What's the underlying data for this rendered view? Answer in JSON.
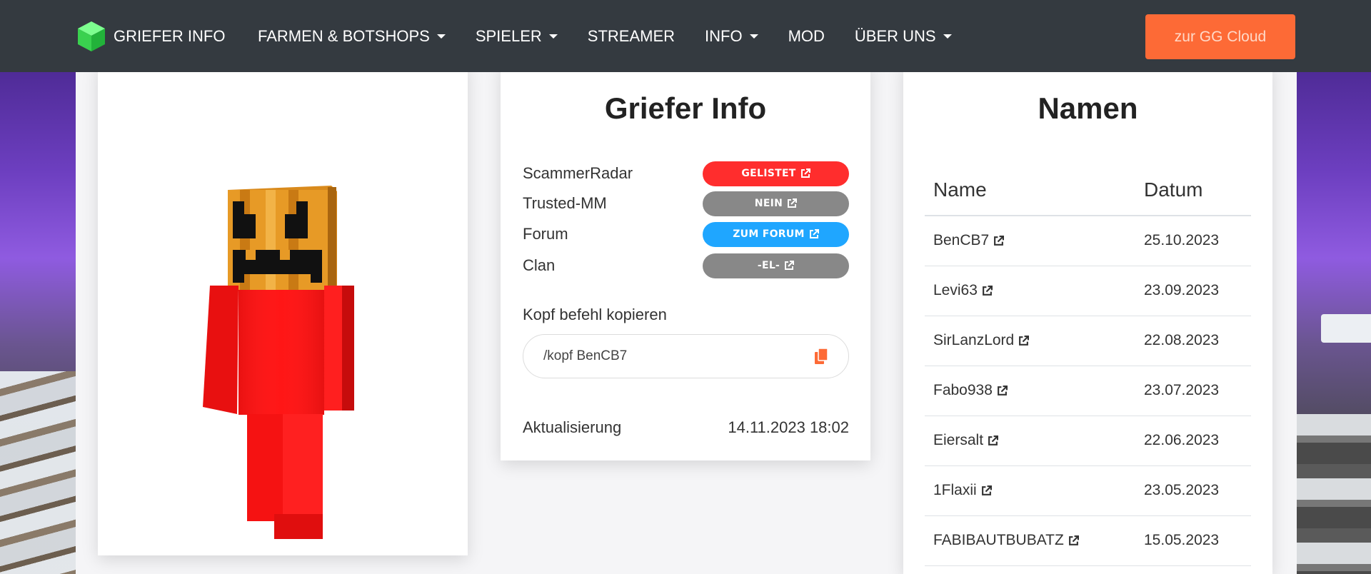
{
  "navbar": {
    "brand": "GRIEFER INFO",
    "items": [
      {
        "label": "FARMEN & BOTSHOPS",
        "dropdown": true
      },
      {
        "label": "SPIELER",
        "dropdown": true
      },
      {
        "label": "STREAMER",
        "dropdown": false
      },
      {
        "label": "INFO",
        "dropdown": true
      },
      {
        "label": "MOD",
        "dropdown": false
      },
      {
        "label": "ÜBER UNS",
        "dropdown": true
      }
    ],
    "cta": "zur GG Cloud"
  },
  "info_card": {
    "title": "Griefer Info",
    "rows": [
      {
        "label": "ScammerRadar",
        "badge": "GELISTET",
        "color": "#ff2d2d"
      },
      {
        "label": "Trusted-MM",
        "badge": "NEIN",
        "color": "#888888"
      },
      {
        "label": "Forum",
        "badge": "ZUM FORUM",
        "color": "#1fa6ff"
      },
      {
        "label": "Clan",
        "badge": "-EL-",
        "color": "#888888"
      }
    ],
    "copy_label": "Kopf befehl kopieren",
    "copy_value": "/kopf BenCB7",
    "update_label": "Aktualisierung",
    "update_value": "14.11.2023 18:02"
  },
  "names_card": {
    "title": "Namen",
    "columns": [
      "Name",
      "Datum"
    ],
    "rows": [
      {
        "name": "BenCB7",
        "date": "25.10.2023"
      },
      {
        "name": "Levi63",
        "date": "23.09.2023"
      },
      {
        "name": "SirLanzLord",
        "date": "22.08.2023"
      },
      {
        "name": "Fabo938",
        "date": "23.07.2023"
      },
      {
        "name": "Eiersalt",
        "date": "22.06.2023"
      },
      {
        "name": "1Flaxii",
        "date": "23.05.2023"
      },
      {
        "name": "FABIBAUTBUBATZ",
        "date": "15.05.2023"
      }
    ]
  },
  "colors": {
    "navbar_bg": "#343a40",
    "cta_bg": "#fd6a36",
    "accent_orange": "#fd6a36"
  }
}
